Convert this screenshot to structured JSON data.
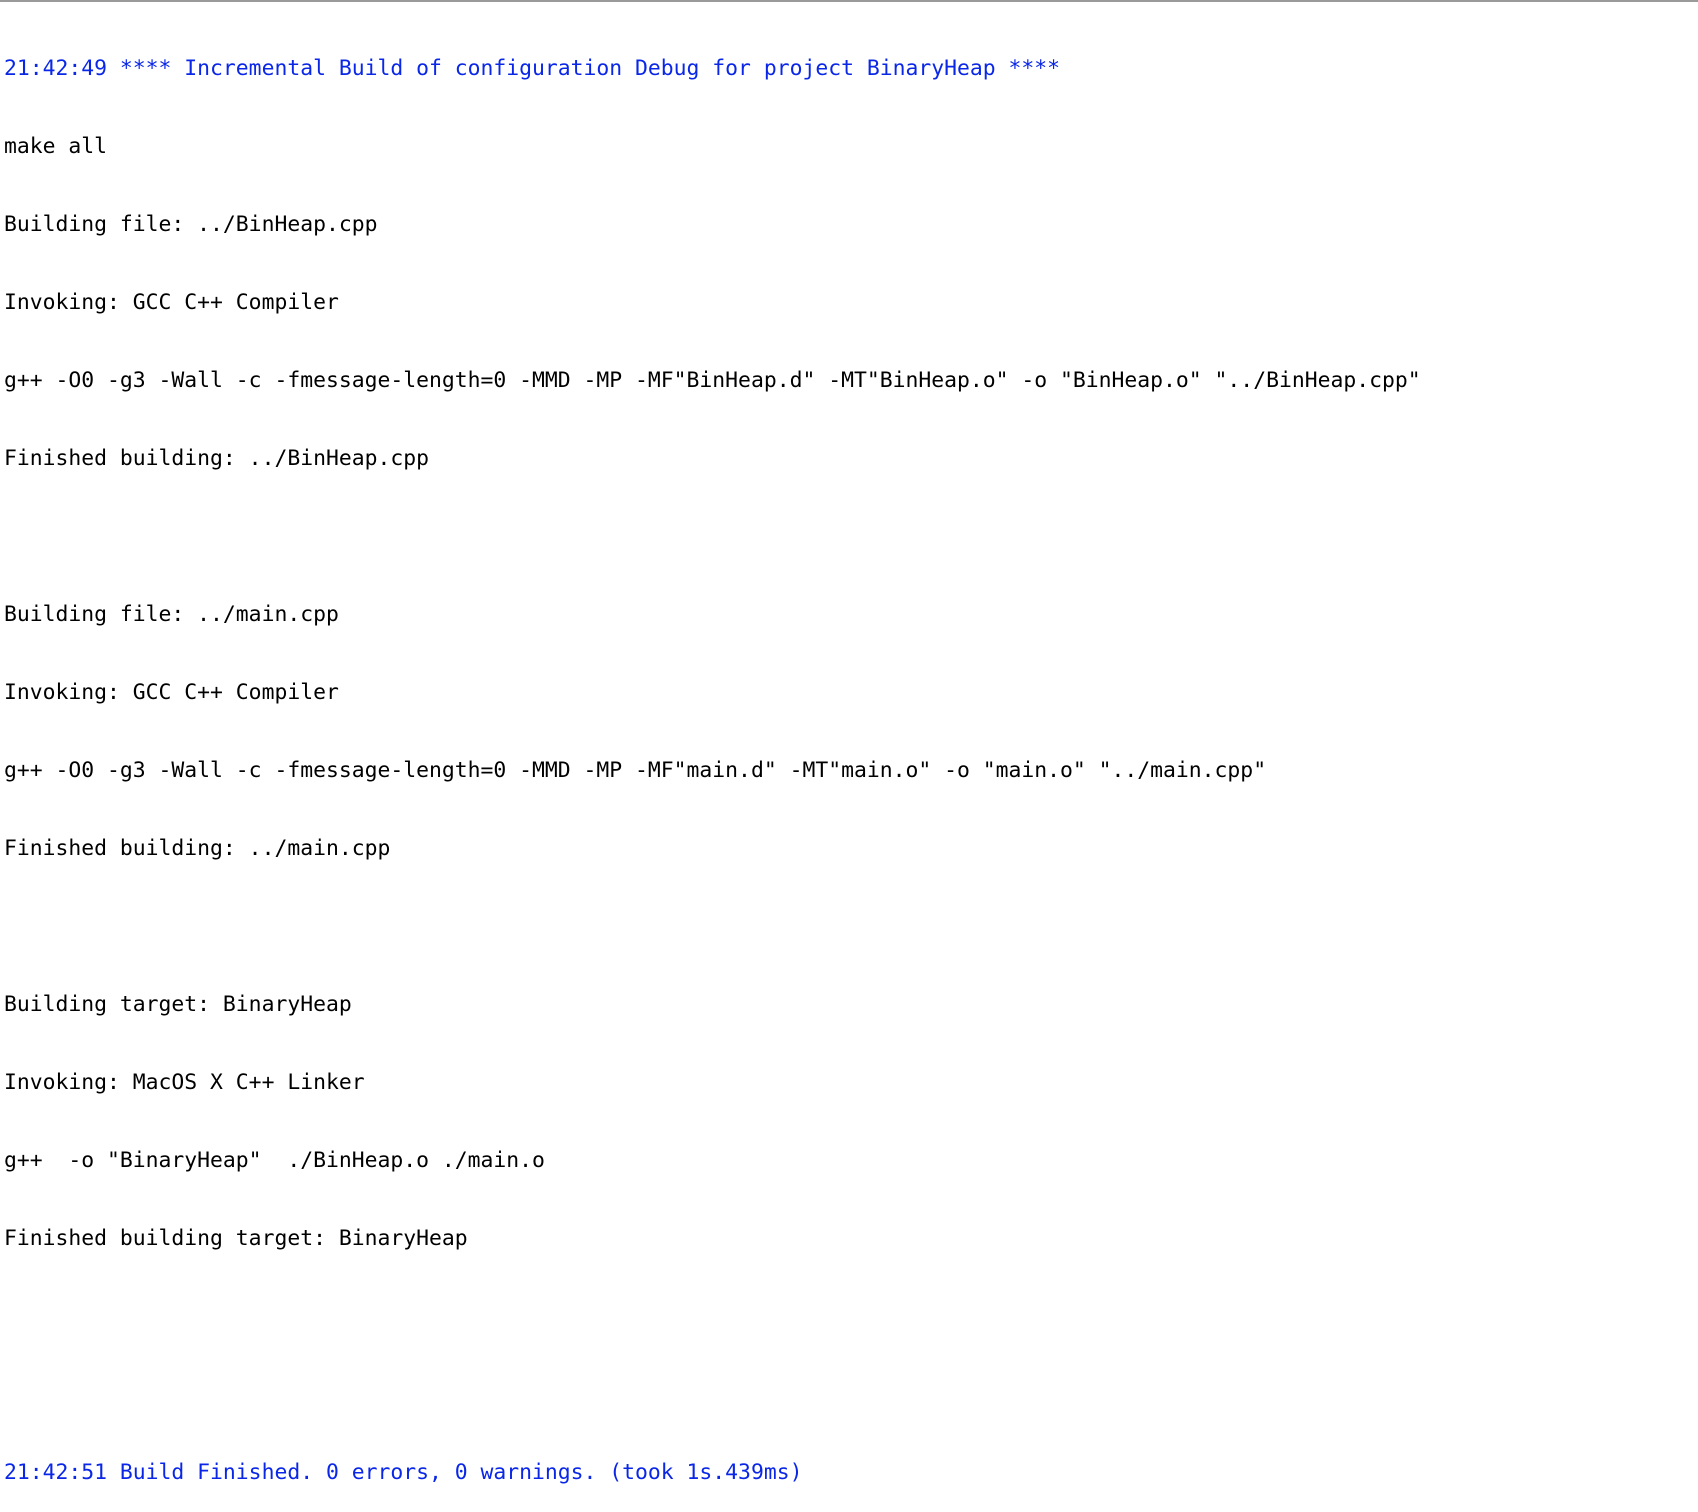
{
  "console": {
    "colors": {
      "normal": "#000000",
      "info": "#0a27e8",
      "background": "#ffffff"
    },
    "lines": [
      {
        "text": "21:42:49 **** Incremental Build of configuration Debug for project BinaryHeap ****",
        "kind": "info"
      },
      {
        "text": "make all",
        "kind": "normal"
      },
      {
        "text": "Building file: ../BinHeap.cpp",
        "kind": "normal"
      },
      {
        "text": "Invoking: GCC C++ Compiler",
        "kind": "normal"
      },
      {
        "text": "g++ -O0 -g3 -Wall -c -fmessage-length=0 -MMD -MP -MF\"BinHeap.d\" -MT\"BinHeap.o\" -o \"BinHeap.o\" \"../BinHeap.cpp\"",
        "kind": "normal"
      },
      {
        "text": "Finished building: ../BinHeap.cpp",
        "kind": "normal"
      },
      {
        "text": "",
        "kind": "blank"
      },
      {
        "text": "Building file: ../main.cpp",
        "kind": "normal"
      },
      {
        "text": "Invoking: GCC C++ Compiler",
        "kind": "normal"
      },
      {
        "text": "g++ -O0 -g3 -Wall -c -fmessage-length=0 -MMD -MP -MF\"main.d\" -MT\"main.o\" -o \"main.o\" \"../main.cpp\"",
        "kind": "normal"
      },
      {
        "text": "Finished building: ../main.cpp",
        "kind": "normal"
      },
      {
        "text": "",
        "kind": "blank"
      },
      {
        "text": "Building target: BinaryHeap",
        "kind": "normal"
      },
      {
        "text": "Invoking: MacOS X C++ Linker",
        "kind": "normal"
      },
      {
        "text": "g++  -o \"BinaryHeap\"  ./BinHeap.o ./main.o",
        "kind": "normal"
      },
      {
        "text": "Finished building target: BinaryHeap",
        "kind": "normal"
      },
      {
        "text": "",
        "kind": "blank"
      },
      {
        "text": "",
        "kind": "blank"
      },
      {
        "text": "21:42:51 Build Finished. 0 errors, 0 warnings. (took 1s.439ms)",
        "kind": "info"
      }
    ]
  }
}
